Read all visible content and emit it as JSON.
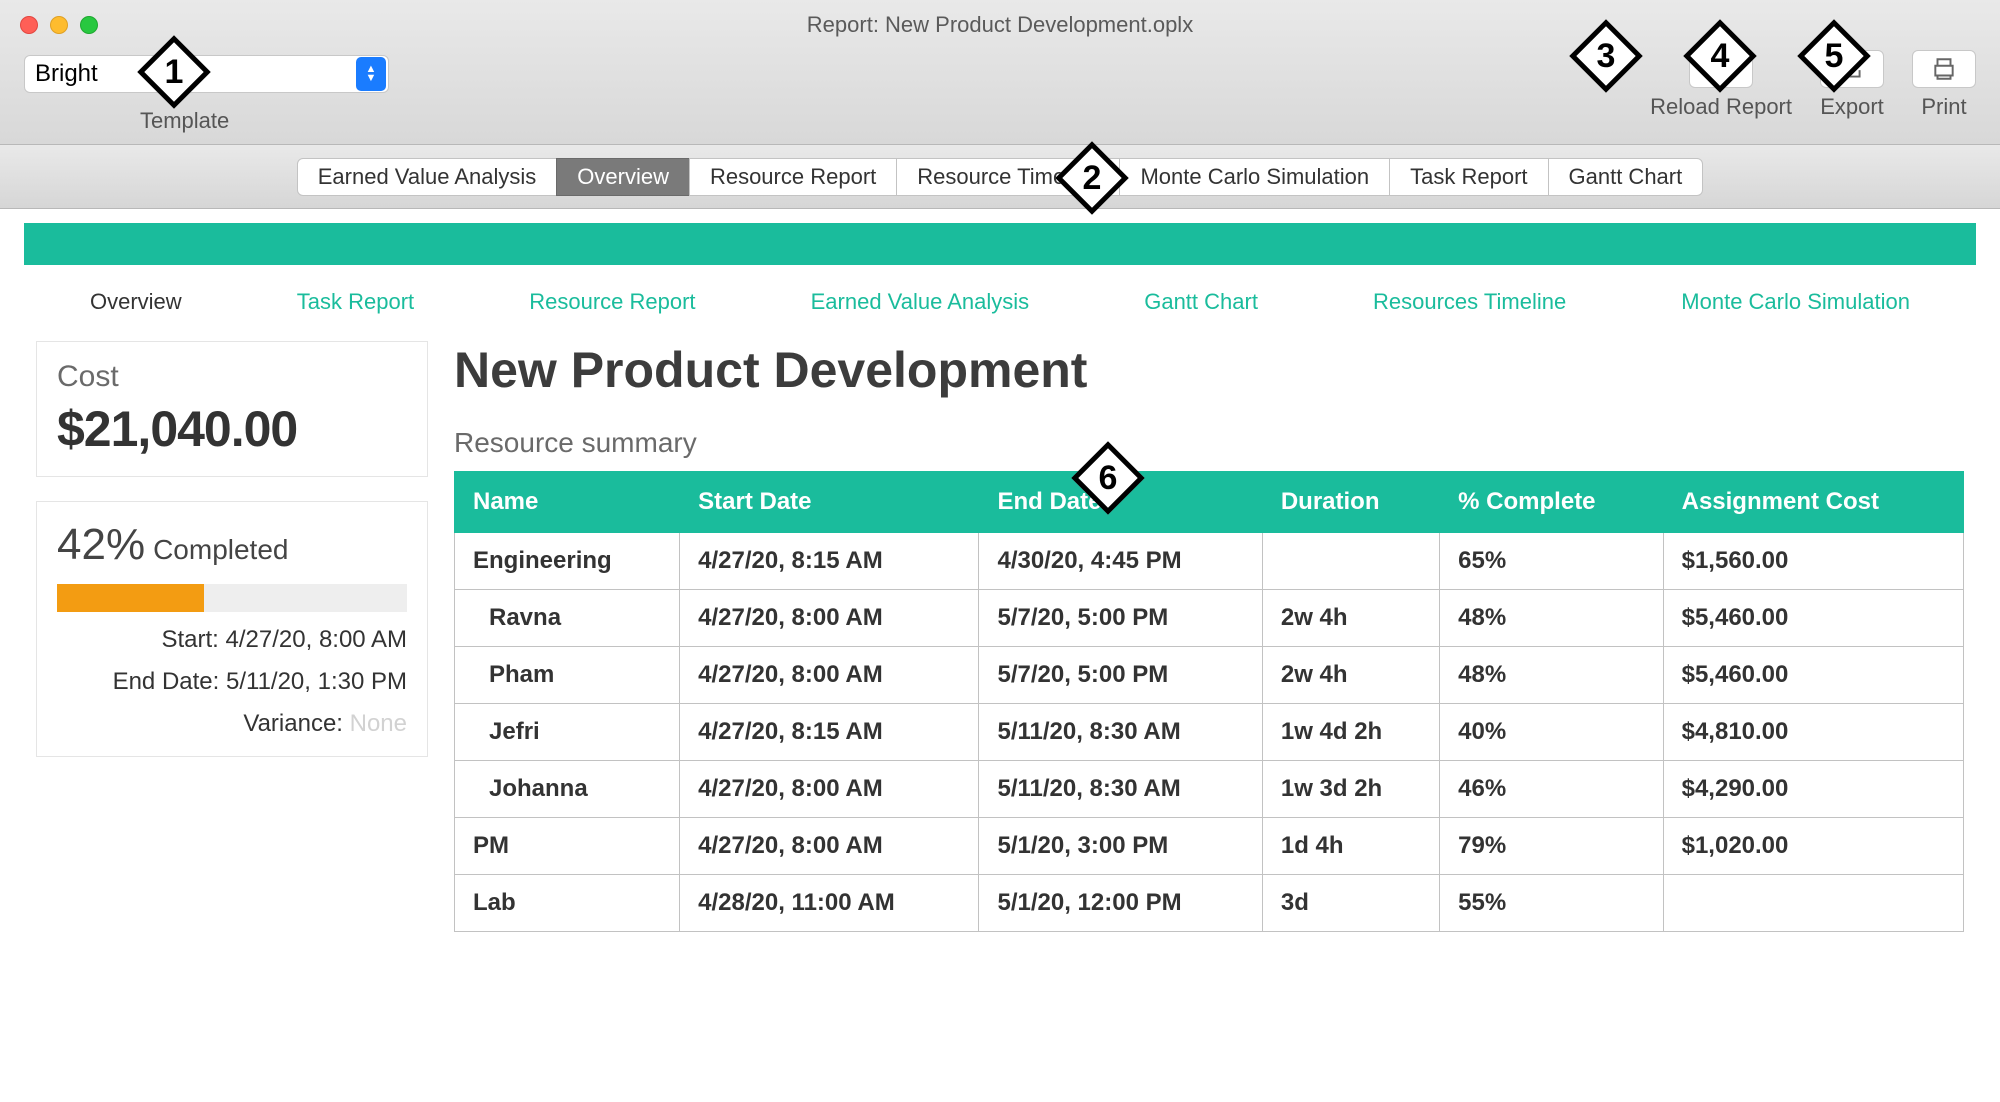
{
  "window": {
    "title": "Report: New Product Development.oplx"
  },
  "template": {
    "label": "Template",
    "value": "Bright"
  },
  "toolbar": {
    "reload_label": "Reload Report",
    "export_label": "Export",
    "print_label": "Print"
  },
  "tabs": [
    "Earned Value Analysis",
    "Overview",
    "Resource Report",
    "Resource Timeline",
    "Monte Carlo Simulation",
    "Task Report",
    "Gantt Chart"
  ],
  "tabs_active_index": 1,
  "report_nav": [
    "Overview",
    "Task Report",
    "Resource Report",
    "Earned Value Analysis",
    "Gantt Chart",
    "Resources Timeline",
    "Monte Carlo Simulation"
  ],
  "report_nav_active_index": 0,
  "summary": {
    "cost_label": "Cost",
    "cost_value": "$21,040.00",
    "percent_value": "42%",
    "percent_label": "Completed",
    "percent_fraction": 0.42,
    "start_label": "Start:",
    "start_value": "4/27/20, 8:00 AM",
    "end_label": "End Date:",
    "end_value": "5/11/20, 1:30 PM",
    "variance_label": "Variance:",
    "variance_value": "None"
  },
  "report": {
    "title": "New Product Development",
    "section": "Resource summary",
    "columns": [
      "Name",
      "Start Date",
      "End Date",
      "Duration",
      "% Complete",
      "Assignment Cost"
    ],
    "rows": [
      {
        "name": "Engineering",
        "indent": 0,
        "start": "4/27/20, 8:15 AM",
        "end": "4/30/20, 4:45 PM",
        "duration": "",
        "complete": "65%",
        "cost": "$1,560.00"
      },
      {
        "name": "Ravna",
        "indent": 1,
        "start": "4/27/20, 8:00 AM",
        "end": "5/7/20, 5:00 PM",
        "duration": "2w 4h",
        "complete": "48%",
        "cost": "$5,460.00"
      },
      {
        "name": "Pham",
        "indent": 1,
        "start": "4/27/20, 8:00 AM",
        "end": "5/7/20, 5:00 PM",
        "duration": "2w 4h",
        "complete": "48%",
        "cost": "$5,460.00"
      },
      {
        "name": "Jefri",
        "indent": 1,
        "start": "4/27/20, 8:15 AM",
        "end": "5/11/20, 8:30 AM",
        "duration": "1w 4d 2h",
        "complete": "40%",
        "cost": "$4,810.00"
      },
      {
        "name": "Johanna",
        "indent": 1,
        "start": "4/27/20, 8:00 AM",
        "end": "5/11/20, 8:30 AM",
        "duration": "1w 3d 2h",
        "complete": "46%",
        "cost": "$4,290.00"
      },
      {
        "name": "PM",
        "indent": 0,
        "start": "4/27/20, 8:00 AM",
        "end": "5/1/20, 3:00 PM",
        "duration": "1d 4h",
        "complete": "79%",
        "cost": "$1,020.00"
      },
      {
        "name": "Lab",
        "indent": 0,
        "start": "4/28/20, 11:00 AM",
        "end": "5/1/20, 12:00 PM",
        "duration": "3d",
        "complete": "55%",
        "cost": ""
      }
    ]
  },
  "callouts": {
    "1": "1",
    "2": "2",
    "3": "3",
    "4": "4",
    "5": "5",
    "6": "6"
  },
  "colors": {
    "accent": "#1abc9c",
    "progress": "#f39c12"
  }
}
